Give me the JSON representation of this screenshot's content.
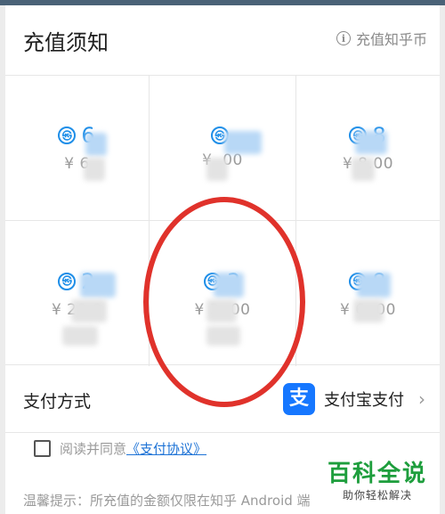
{
  "header": {
    "title": "充值须知",
    "coin_info_label": "充值知乎币"
  },
  "packages": [
    {
      "amount": "6",
      "price": "¥ 6"
    },
    {
      "amount": "",
      "price": "¥ .00"
    },
    {
      "amount": "8",
      "price": "¥ 8.00"
    },
    {
      "amount": "2",
      "price": "¥ 29 0"
    },
    {
      "amount": "3",
      "price": "¥ 3 .00"
    },
    {
      "amount": "8",
      "price": "¥ 6 .00"
    }
  ],
  "payment": {
    "label": "支付方式",
    "method_icon": "支",
    "method_label": "支付宝支付"
  },
  "agreement": {
    "text": "阅读并同意",
    "link": "《支付协议》"
  },
  "tip": "温馨提示：所充值的金额仅限在知乎 Android 端",
  "watermark": {
    "title": "百科全说",
    "subtitle": "助你轻松解决"
  },
  "colors": {
    "accent": "#1e8ee8",
    "annotation": "#e0322b",
    "alipay": "#1677ff"
  }
}
